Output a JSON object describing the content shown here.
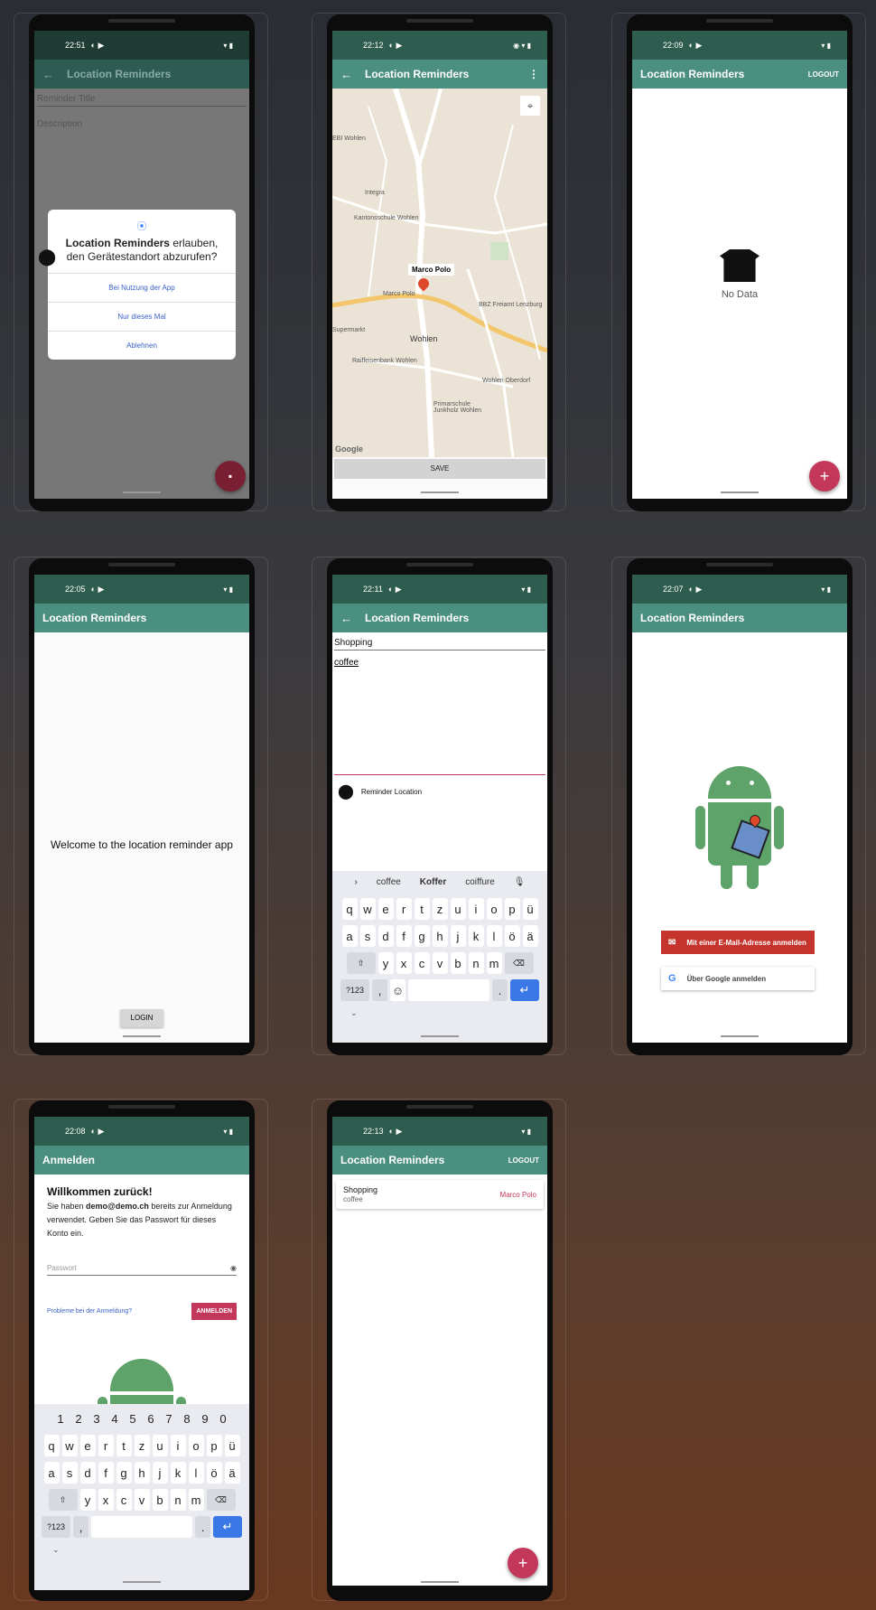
{
  "p1": {
    "time": "22:51",
    "title": "Location Reminders",
    "field_title": "Reminder Title",
    "field_desc": "Description",
    "dialog": {
      "app": "Location Reminders",
      "question": " erlauben, den Gerätestandort abzurufen?",
      "opt1": "Bei Nutzung der App",
      "opt2": "Nur dieses Mal",
      "opt3": "Ablehnen"
    }
  },
  "p2": {
    "time": "22:12",
    "title": "Location Reminders",
    "save": "SAVE",
    "marker": "Marco Polo",
    "places": [
      "EBI Wohlen",
      "Integra",
      "Kantonsschule Wohlen",
      "Marco Polo",
      "BBZ Freiamt Lenzburg",
      "Supermarkt",
      "Wohlen",
      "Raiffeisenbank Wohlen",
      "Wohlen Oberdorf",
      "Primarschule Junkholz Wohlen",
      "Google"
    ]
  },
  "p3": {
    "time": "22:09",
    "title": "Location Reminders",
    "logout": "LOGOUT",
    "empty": "No Data",
    "fab": "+"
  },
  "p4": {
    "time": "22:05",
    "title": "Location Reminders",
    "welcome": "Welcome to the location reminder app",
    "login": "LOGIN"
  },
  "p5": {
    "time": "22:11",
    "title": "Location Reminders",
    "reminder_title": "Shopping",
    "reminder_desc": "coffee",
    "location_label": "Reminder Location",
    "suggestions": [
      "coffee",
      "Koffer",
      "coiffure"
    ],
    "row1": [
      "q",
      "w",
      "e",
      "r",
      "t",
      "z",
      "u",
      "i",
      "o",
      "p",
      "ü"
    ],
    "row2": [
      "a",
      "s",
      "d",
      "f",
      "g",
      "h",
      "j",
      "k",
      "l",
      "ö",
      "ä"
    ],
    "row3": [
      "y",
      "x",
      "c",
      "v",
      "b",
      "n",
      "m"
    ],
    "sym": "?123",
    "comma": ",",
    "period": "."
  },
  "p6": {
    "time": "22:07",
    "title": "Location Reminders",
    "email_btn": "Mit einer E-Mail-Adresse anmelden",
    "google_btn": "Über Google anmelden"
  },
  "p7": {
    "time": "22:08",
    "title": "Anmelden",
    "welcome": "Willkommen zurück!",
    "msg_pre": "Sie haben ",
    "msg_email": "demo@demo.ch",
    "msg_post": " bereits zur Anmeldung verwendet. Geben Sie das Passwort für dieses Konto ein.",
    "password_placeholder": "Passwort",
    "trouble": "Probleme bei der Anmeldung?",
    "signin": "ANMELDEN",
    "nums": [
      "1",
      "2",
      "3",
      "4",
      "5",
      "6",
      "7",
      "8",
      "9",
      "0"
    ],
    "row1": [
      "q",
      "w",
      "e",
      "r",
      "t",
      "z",
      "u",
      "i",
      "o",
      "p",
      "ü"
    ],
    "row2": [
      "a",
      "s",
      "d",
      "f",
      "g",
      "h",
      "j",
      "k",
      "l",
      "ö",
      "ä"
    ],
    "row3": [
      "y",
      "x",
      "c",
      "v",
      "b",
      "n",
      "m"
    ],
    "sym": "?123",
    "comma": ",",
    "period": "."
  },
  "p8": {
    "time": "22:13",
    "title": "Location Reminders",
    "logout": "LOGOUT",
    "item_title": "Shopping",
    "item_desc": "coffee",
    "item_loc": "Marco Polo",
    "fab": "+"
  }
}
